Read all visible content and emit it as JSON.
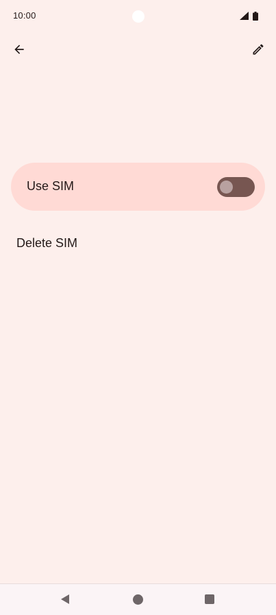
{
  "status_bar": {
    "time": "10:00",
    "icons": [
      "signal-icon",
      "battery-icon"
    ]
  },
  "app_bar": {
    "back_icon": "arrow-back-icon",
    "edit_icon": "pencil-icon"
  },
  "use_sim": {
    "label": "Use SIM",
    "toggle_state": "off"
  },
  "delete_sim": {
    "label": "Delete SIM"
  },
  "nav_bar": {
    "icons": [
      "nav-back-icon",
      "nav-home-icon",
      "nav-recents-icon"
    ]
  },
  "colors": {
    "background": "#fdefec",
    "card": "#ffdad5",
    "toggle_track": "#775651",
    "toggle_thumb": "#b8a1a0",
    "text": "#231918",
    "nav_bar": "#fbf4f6"
  }
}
